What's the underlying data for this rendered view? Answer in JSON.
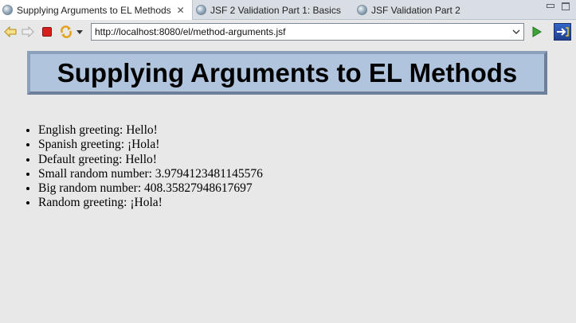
{
  "tabs": [
    {
      "label": "Supplying Arguments to EL Methods",
      "active": true
    },
    {
      "label": "JSF 2 Validation Part 1: Basics",
      "active": false
    },
    {
      "label": "JSF Validation Part 2",
      "active": false
    }
  ],
  "toolbar": {
    "url": "http://localhost:8080/el/method-arguments.jsf"
  },
  "page": {
    "title": "Supplying Arguments to EL Methods",
    "items": [
      {
        "label": "English greeting:",
        "value": "Hello!"
      },
      {
        "label": "Spanish greeting:",
        "value": "¡Hola!"
      },
      {
        "label": "Default greeting:",
        "value": "Hello!"
      },
      {
        "label": "Small random number:",
        "value": "3.9794123481145576"
      },
      {
        "label": "Big random number:",
        "value": "408.35827948617697"
      },
      {
        "label": "Random greeting:",
        "value": "¡Hola!"
      }
    ]
  },
  "colors": {
    "title_bg": "#b0c4de",
    "title_border": "#6d8099",
    "page_bg": "#e8e8e8"
  },
  "icons": [
    "back-arrow-icon",
    "forward-arrow-icon",
    "stop-icon",
    "refresh-icon",
    "menu-dropdown-icon",
    "url-dropdown-icon",
    "go-icon",
    "external-browser-icon",
    "minimize-icon",
    "maximize-icon",
    "close-icon",
    "globe-icon"
  ]
}
